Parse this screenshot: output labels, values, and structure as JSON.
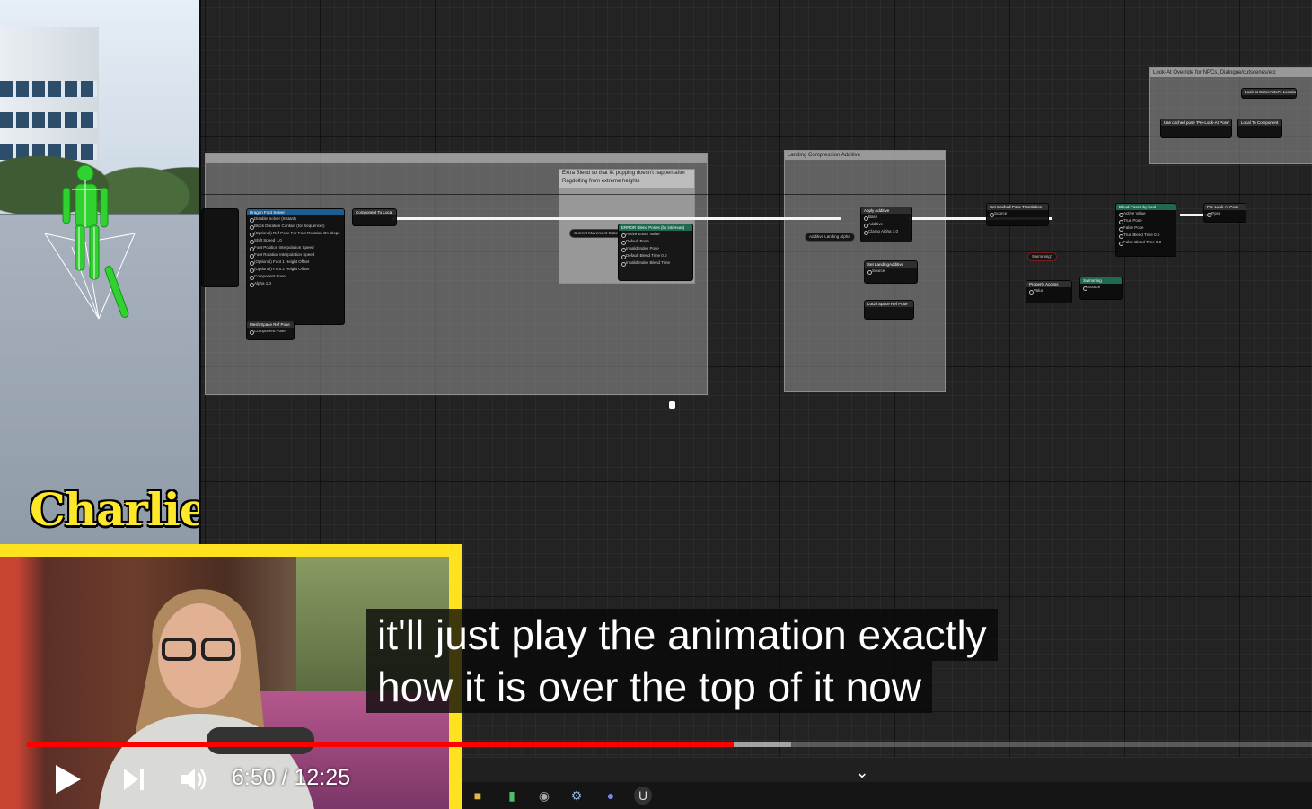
{
  "video": {
    "streamer_name": "Charlie",
    "caption_lines": [
      "it'll just play the animation exactly",
      "how it is over the top of it now"
    ],
    "time_current": "6:50",
    "time_separator": "/",
    "time_total": "12:25",
    "progress_fraction": 0.55,
    "buffer_fraction": 0.595,
    "colors": {
      "progress": "#ff0000",
      "name": "#ffe82a",
      "webcam_border": "#ffe21f"
    }
  },
  "graph": {
    "comments": [
      {
        "title": ""
      },
      {
        "title": "Extra Blend so that IK popping doesn't happen after Ragdolling from extreme heights"
      },
      {
        "title": "Landing Compression Additive"
      },
      {
        "title": "Look-At Override for NPCs, Dialogue/cutscenes/etc"
      }
    ],
    "nodes": {
      "dragon_foot_solver": {
        "title": "Dragon Foot Solver",
        "rows": [
          "Disable Solver (Instant)",
          "Block Duration Contain (for Sequencer)",
          "(Optional) Ref Pose For Foot Rotation On Slope",
          "Shift Speed 1.0",
          "Foot Position Interpolation Speed",
          "Foot Rotation Interpolation Speed",
          "(Optional) Foot 1 Height Offset",
          "(Optional) Foot 2 Height Offset",
          "Component Pose",
          "Alpha 1.0"
        ]
      },
      "mesh_space_ref_pose": {
        "title": "Mesh Space Ref Pose",
        "rows": [
          "Component Pose"
        ]
      },
      "component_to_local": {
        "title": "Component To Local"
      },
      "blend_poses": {
        "title": "ERROR Blend Poses (by int/enum)",
        "rows": [
          "Active Enum Value",
          "Default Pose",
          "Invalid Index Pose",
          "Default Blend Time 0.0",
          "Invalid Index Blend Time"
        ]
      },
      "current_movement_state": {
        "label": "Current Movement State"
      },
      "apply_additive": {
        "title": "Apply Additive",
        "rows": [
          "Base",
          "Additive",
          "Clamp Alpha 1.0"
        ]
      },
      "additive_landing_alpha": {
        "label": "Additive Landing Alpha"
      },
      "set_landing_additive": {
        "title": "Set LandingAdditive",
        "rows": [
          "Source"
        ]
      },
      "local_space_ref_pose": {
        "title": "Local Space Ref Pose"
      },
      "set_cached_pose": {
        "title": "Set Cached Pose Translation",
        "rows": [
          "Source"
        ]
      },
      "swimming_var": {
        "label": "Swimming?"
      },
      "property_access": {
        "title": "Property Access",
        "rows": [
          "Value"
        ]
      },
      "blend_poses_bool": {
        "title": "Blend Poses by bool",
        "rows": [
          "Active Value",
          "True Pose",
          "False Pose",
          "True Blend Time 0.0",
          "False Blend Time 0.0"
        ]
      },
      "swimming_pose": {
        "title": "Swimming",
        "rows": [
          "Source"
        ]
      },
      "pre_look_at_pose": {
        "title": "Pre-Look-At Pose",
        "rows": [
          "Pose"
        ]
      },
      "use_cached_pre_look_at": {
        "title": "Use cached pose 'Pre-Look-At Pose'"
      },
      "local_to_component": {
        "title": "Local To Component"
      },
      "look_at_override": {
        "title": "Look at SomeActor's Location"
      }
    }
  },
  "taskbar": {
    "icons": [
      "file-explorer-icon",
      "audio-meter-icon",
      "obs-icon",
      "steam-icon",
      "discord-icon",
      "unreal-engine-icon"
    ]
  }
}
